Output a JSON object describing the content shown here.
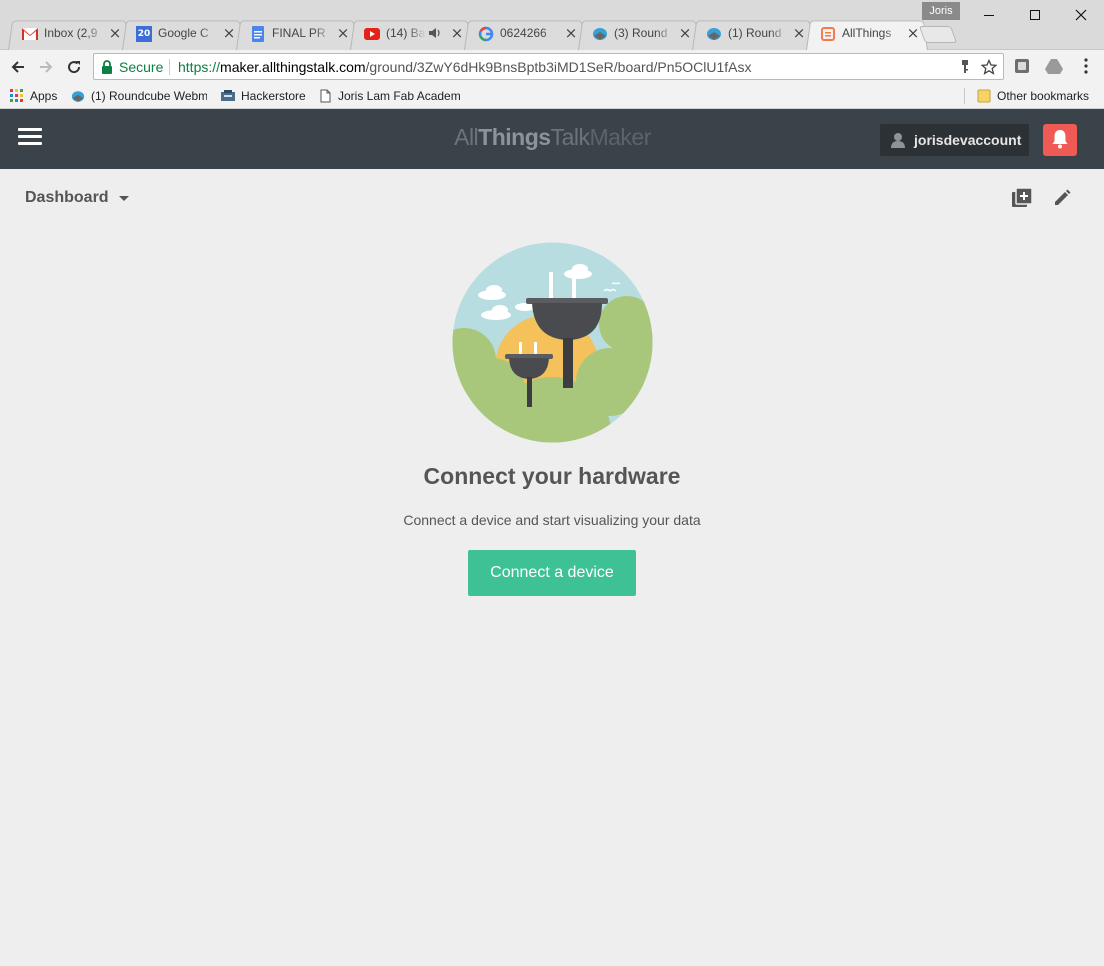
{
  "browser": {
    "profile_name": "Joris",
    "tabs": [
      {
        "label": "Inbox (2,9",
        "icon": "gmail-icon"
      },
      {
        "label": "Google C",
        "icon": "google-calendar-icon",
        "icon_text": "20"
      },
      {
        "label": "FINAL PR",
        "icon": "google-docs-icon"
      },
      {
        "label": "(14) Ba",
        "icon": "youtube-icon"
      },
      {
        "label": "0624266",
        "icon": "google-icon"
      },
      {
        "label": "(3) Round",
        "icon": "roundcube-icon"
      },
      {
        "label": "(1) Round",
        "icon": "roundcube-icon"
      },
      {
        "label": "AllThings",
        "icon": "allthingstalk-icon",
        "active": true
      }
    ],
    "address_bar": {
      "security_label": "Secure",
      "url_scheme": "https://",
      "url_host": "maker.allthingstalk.com",
      "url_path": "/ground/3ZwY6dHk9BnsBptb3iMD1SeR/board/Pn5OClU1fAsx"
    },
    "bookmarks": [
      {
        "label": "Apps",
        "icon": "apps-grid-icon"
      },
      {
        "label": "(1) Roundcube Webm",
        "icon": "roundcube-icon"
      },
      {
        "label": "Hackerstore",
        "icon": "hackerstore-icon"
      },
      {
        "label": "Joris Lam Fab Academ",
        "icon": "page-icon"
      }
    ],
    "other_bookmarks_label": "Other bookmarks"
  },
  "app": {
    "logo_prefix": "All",
    "logo_bold": "Things",
    "logo_mid": "Talk",
    "logo_suffix": "Maker",
    "username": "jorisdevaccount",
    "dashboard_label": "Dashboard",
    "empty_state": {
      "title": "Connect your hardware",
      "subtitle": "Connect a device and start visualizing your data",
      "button_label": "Connect a device"
    }
  },
  "colors": {
    "header_bg": "#3b434a",
    "accent_green": "#3ec295",
    "bell_red": "#f05a55",
    "page_bg": "#eeeeee"
  }
}
